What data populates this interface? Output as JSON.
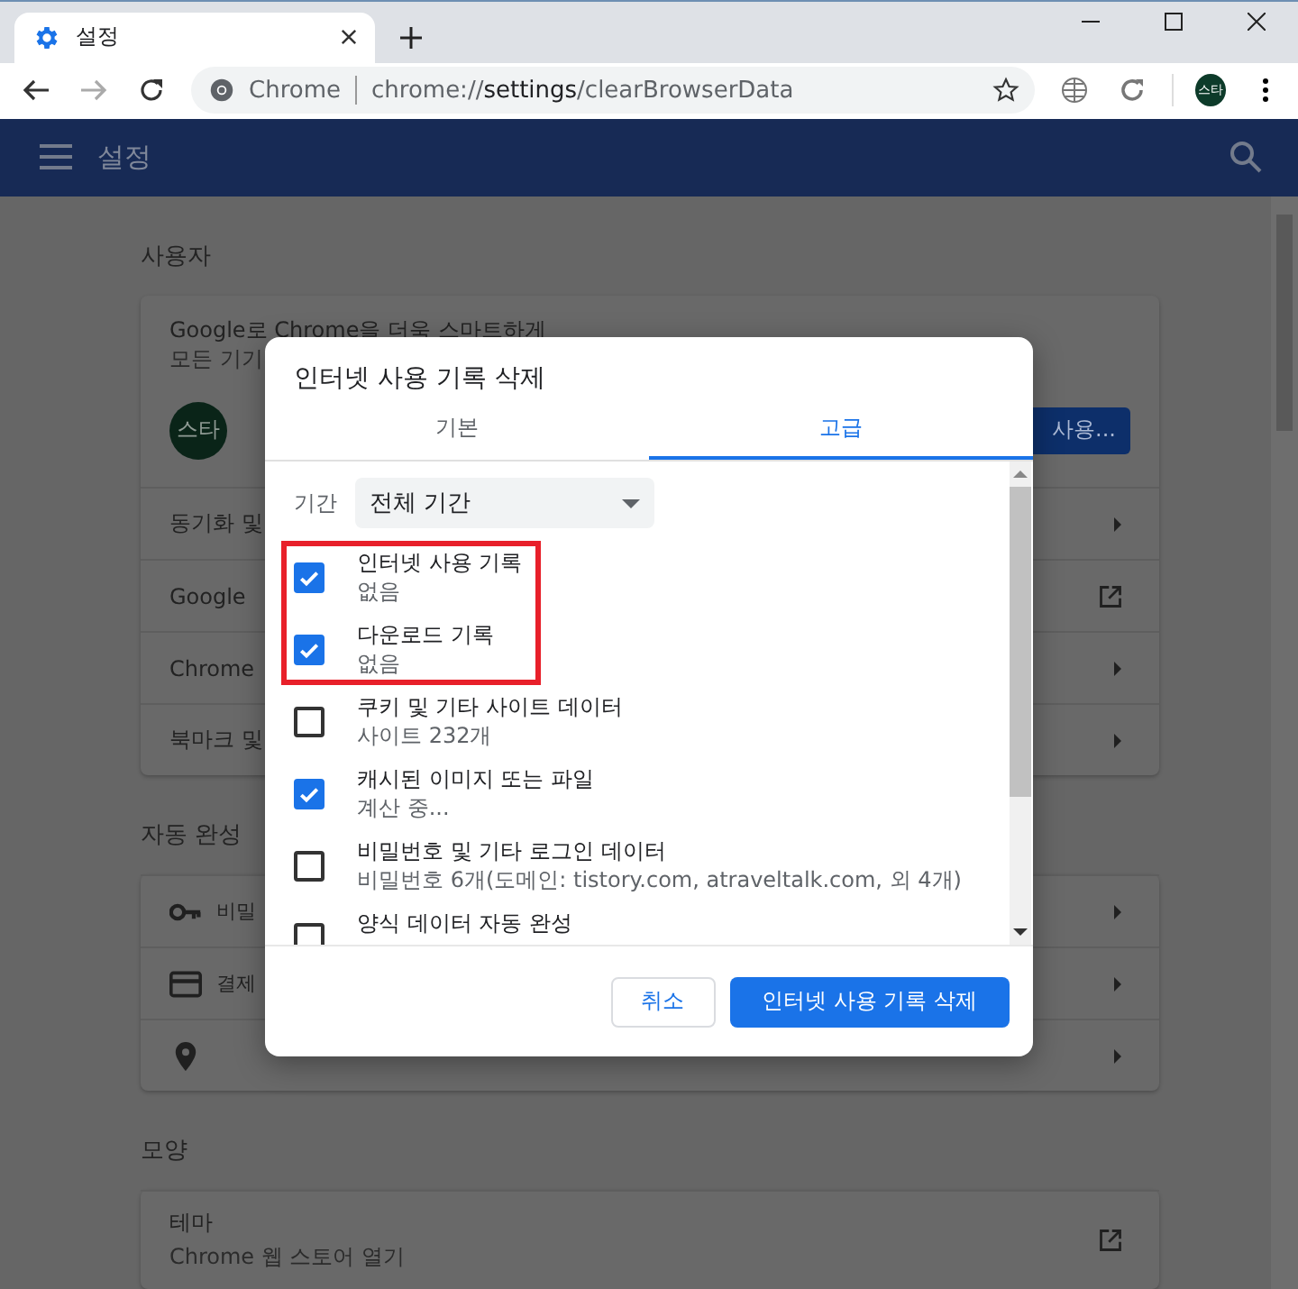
{
  "browser": {
    "tab_title": "설정",
    "site_label": "Chrome",
    "url": "chrome://**settings**/clearBrowserData",
    "profile": "스타"
  },
  "app_bar": {
    "title": "설정"
  },
  "people": {
    "title": "사용자",
    "promo_title": "Google로 Chrome을 더욱 스마트하게",
    "promo_subtitle": "모든 기기",
    "avatar": "스타",
    "sync_button": "사용...",
    "rows": [
      {
        "label": "동기화 및",
        "kind": "subpage"
      },
      {
        "label": "Google",
        "kind": "external"
      },
      {
        "label": "Chrome",
        "kind": "subpage"
      },
      {
        "label": "북마크 및",
        "kind": "subpage"
      }
    ]
  },
  "autofill": {
    "title": "자동 완성",
    "rows": [
      {
        "label": "비밀",
        "kind": "subpage"
      },
      {
        "label": "결제",
        "kind": "subpage"
      },
      {
        "kind": "subpage"
      }
    ]
  },
  "appearance": {
    "title": "모양",
    "rows": [
      {
        "label": "테마",
        "subtitle": "Chrome 웹 스토어 열기",
        "kind": "external"
      }
    ]
  },
  "dialog": {
    "title": "인터넷 사용 기록 삭제",
    "tabs": [
      {
        "label": "기본",
        "selected": false
      },
      {
        "label": "고급",
        "selected": true
      }
    ],
    "period_label": "기간",
    "period_value": "전체 기간",
    "items": [
      {
        "title": "인터넷 사용 기록",
        "detail": "없음",
        "checked": true,
        "highlighted": true
      },
      {
        "title": "다운로드 기록",
        "detail": "없음",
        "checked": true,
        "highlighted": true
      },
      {
        "title": "쿠키 및 기타 사이트 데이터",
        "detail": "사이트 232개",
        "checked": false,
        "highlighted": false
      },
      {
        "title": "캐시된 이미지 또는 파일",
        "detail": "계산 중...",
        "checked": true,
        "highlighted": false
      },
      {
        "title": "비밀번호 및 기타 로그인 데이터",
        "detail": "비밀번호 6개(도메인: tistory.com, atraveltalk.com, 외 4개)",
        "checked": false,
        "highlighted": false
      },
      {
        "title": "양식 데이터 자동 완성",
        "checked": false,
        "highlighted": false
      }
    ],
    "buttons": [
      {
        "label": "취소",
        "kind": "secondary"
      },
      {
        "label": "인터넷 사용 기록 삭제",
        "kind": "primary"
      }
    ]
  }
}
